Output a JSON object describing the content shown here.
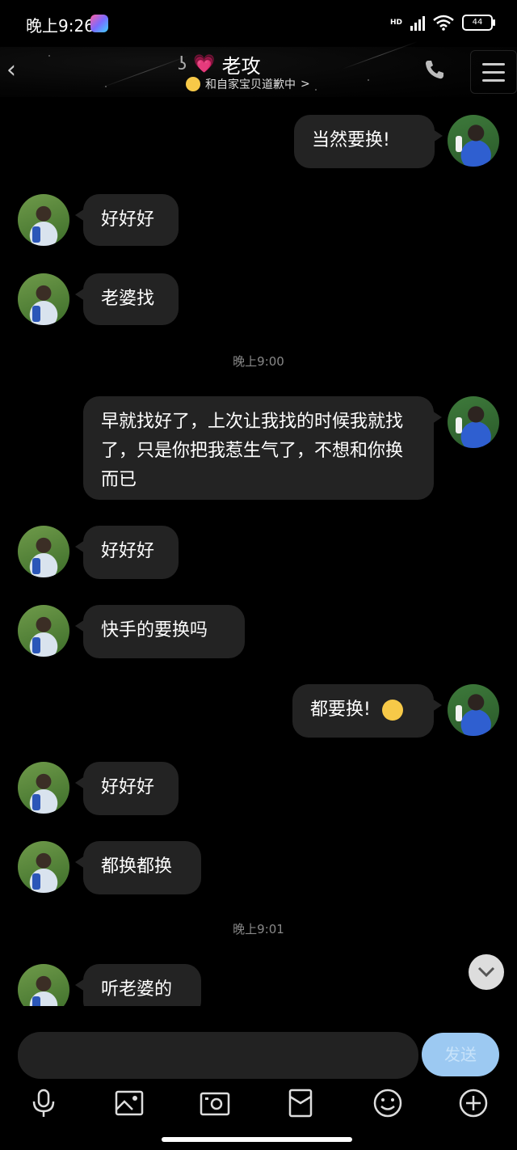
{
  "status_bar": {
    "time": "晚上9:26",
    "network": "HD",
    "battery": "44"
  },
  "header": {
    "title": "老攻",
    "subtitle": "和自家宝贝道歉中",
    "subtitle_chevron": ">"
  },
  "messages": [
    {
      "side": "right",
      "text": "当然要换!"
    },
    {
      "side": "left",
      "text": "好好好"
    },
    {
      "side": "left",
      "text": "老婆找"
    },
    {
      "type": "time",
      "text": "晚上9:00"
    },
    {
      "side": "right",
      "text": "早就找好了，上次让我找的时候我就找了，只是你把我惹生气了，不想和你换而已"
    },
    {
      "side": "left",
      "text": "好好好"
    },
    {
      "side": "left",
      "text": "快手的要换吗"
    },
    {
      "side": "right",
      "text": "都要换!",
      "emoji": "confused-emoji"
    },
    {
      "side": "left",
      "text": "好好好"
    },
    {
      "side": "left",
      "text": "都换都换"
    },
    {
      "type": "time",
      "text": "晚上9:01"
    },
    {
      "side": "left",
      "text": "听老婆的"
    }
  ],
  "composer": {
    "input_value": "",
    "send_label": "发送"
  },
  "toolbar_icons": [
    "mic-icon",
    "image-icon",
    "camera-icon",
    "red-packet-icon",
    "emoji-icon",
    "plus-icon"
  ],
  "colors": {
    "background": "#000000",
    "bubble": "#232323",
    "send": "#9cc9f2"
  }
}
